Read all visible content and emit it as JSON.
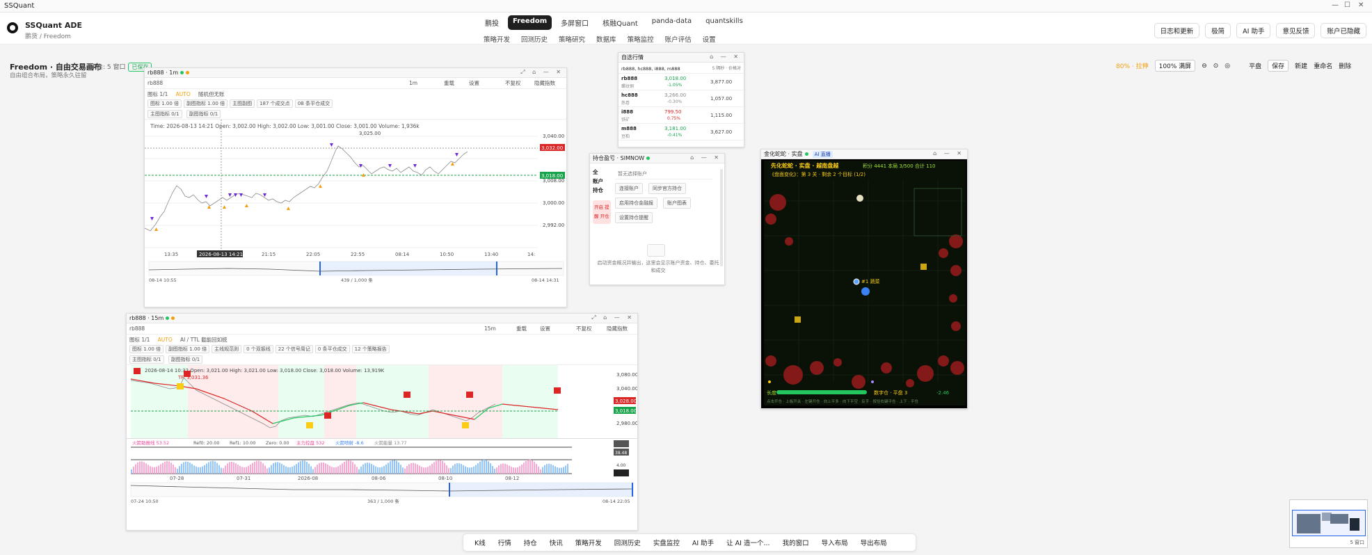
{
  "window": {
    "title": "SSQuant"
  },
  "header": {
    "brand": "SSQuant ADE",
    "breadcrumb": "鹏货 / Freedom",
    "nav_row1": [
      "鹏投",
      "Freedom",
      "多屏窗口",
      "核融Quant",
      "panda-data",
      "quantskills"
    ],
    "nav_row2": [
      "策略开发",
      "回测历史",
      "策略研究",
      "数据库",
      "策略监控",
      "账户评估",
      "设置"
    ],
    "right_buttons": [
      "日志和更新",
      "极简",
      "AI 助手",
      "意见反馈",
      "账户已隐藏"
    ]
  },
  "page": {
    "title": "Freedom · 自由交易画布",
    "meta": "平台: 5 窗口",
    "badge": "已保存",
    "subtitle": "自由组合布局，策略永久驻留",
    "zoom_hint": "80% · 拉伸",
    "zoom": "100% 满屏",
    "layout_select": "平盘",
    "actions": [
      "保存",
      "新建",
      "重命名",
      "删除"
    ]
  },
  "kline1": {
    "title": "rb888 · 1m",
    "symbol": "rb888",
    "period": "1m",
    "toolbar": [
      "重载",
      "设置",
      "不复权",
      "隐藏指数"
    ],
    "tabs": [
      "图标 1/1",
      "AUTO",
      "随机但无账"
    ],
    "chips": [
      "图标 1.00 倍",
      "副图指标 1.00 倍",
      "主图副图",
      "187 个成交点",
      "0B 条平仓成交"
    ],
    "subtabs": [
      "主图指标 0/1",
      "副图指标 0/1"
    ],
    "ohlc": "Time: 2026-08-13 14:21    Open: 3,002.00    High: 3,002.00    Low: 3,001.00    Close: 3,001.00    Volume: 1,936k",
    "price_ticks": [
      "3,040.00",
      "3,032.00",
      "3,024.00",
      "3,018.00",
      "3,008.00",
      "3,000.00",
      "2,992.00"
    ],
    "last_price": "3,032.00",
    "pos_price": "3,018.00",
    "peak_label": "3,025.00",
    "x_ticks": [
      "13:35",
      "2026-08-13 14:21",
      "21:15",
      "22:05",
      "22:55",
      "08:14",
      "10:50",
      "13:40",
      "14:"
    ],
    "range_left": "08-14 10:55",
    "range_mid": "439 / 1,000 条",
    "range_right": "08-14 14:31"
  },
  "kline2": {
    "title": "rb888 · 15m",
    "symbol": "rb888",
    "period": "15m",
    "toolbar": [
      "重载",
      "设置",
      "不复权",
      "隐藏指数"
    ],
    "tabs": [
      "图标 1/1",
      "AUTO",
      "AI / TTL 截能回如统"
    ],
    "chips": [
      "图标 1.00 倍",
      "副图指标 1.00 倍",
      "主线规范则",
      "0 个双振线",
      "22 个信号周记",
      "0 条平仓成交",
      "12 个策略报告"
    ],
    "subtabs": [
      "主图指标 0/1",
      "副图指标 0/1"
    ],
    "ohlc": "2026-08-14 10:32    Open: 3,021.00    High: 3,021.00    Low: 3,018.00    Close: 3,018.00    Volume: 13,919K",
    "indicator": "TF: 3,031.36",
    "price_ticks": [
      "3,080.00",
      "3,040.00",
      "3,010.00",
      "2,980.00"
    ],
    "last_price": "3,028.00",
    "pos_price": "3,018.00",
    "osc_labels": [
      "火箭助推线 53.52",
      "Ref0: 20.00",
      "Ref1: 10.00",
      "Zero: 0.00",
      "主力控盘 532",
      "火箭喷射 -8.6",
      "火箭能量 13.77"
    ],
    "osc_ticks": [
      "38.48",
      "4.00"
    ],
    "x_ticks": [
      "07-28",
      "07-31",
      "2026-08",
      "08-06",
      "08-10",
      "08-12"
    ],
    "range_left": "07-24 10:50",
    "range_mid": "363 / 1,000 条",
    "range_right": "08-14 22:05"
  },
  "quotes": {
    "title": "自选行情",
    "symbols_input": "rb888, hc888, i888, m888",
    "hint": "5 隔秒 · 价格对",
    "rows": [
      {
        "sym": "rb888",
        "name": "螺纹钢",
        "price": "3,018.00",
        "chg": "-1.05%",
        "vol": "3,877.00",
        "color": "#16a34a"
      },
      {
        "sym": "hc888",
        "name": "热卷",
        "price": "3,266.00",
        "chg": "-0.30%",
        "vol": "1,057.00",
        "color": "#888888"
      },
      {
        "sym": "i888",
        "name": "铁矿",
        "price": "799.50",
        "chg": "0.75%",
        "vol": "1,115.00",
        "color": "#dc2626"
      },
      {
        "sym": "m888",
        "name": "豆粕",
        "price": "3,181.00",
        "chg": "-0.41%",
        "vol": "3,627.00",
        "color": "#16a34a"
      }
    ]
  },
  "positions": {
    "title": "持仓盈亏 · SIMNOW",
    "side_labels": [
      "全",
      "账户",
      "持仓"
    ],
    "selector": "暂无选择账户",
    "buttons": [
      "连接账户",
      "同步官方持仓",
      "启用持仓金融报",
      "账户图表",
      "设置持仓提醒"
    ],
    "side_button": "开启 提醒 开仓",
    "empty_text": "启动资金概况并输出，这里会显示账户资金、持仓、委托和成交"
  },
  "game": {
    "title": "金化蛇蛇 · 实盘",
    "tag": "AI 直播",
    "banner": "先化蛇蛇 · 实盘 · 越南盘越",
    "stats": "积分 4441   本局 3/500   合计 110",
    "sub": "《盘面变化》：第 3 关 · 剩余 2 个目标 (1/2)",
    "player": "#1 蔬菜",
    "footer_left": "长度",
    "footer_mid": "数字仓 · 平盘 3",
    "footer_val": "-2.46",
    "footer2": "点击开仓 · 上板开关 · 左键开仓 · 向上平多 · 向下平空 · 反手 · 按住右键平仓 · 上下 · 平仓"
  },
  "bottombar": [
    "K线",
    "行情",
    "持仓",
    "快讯",
    "策略开发",
    "回测历史",
    "实盘监控",
    "AI 助手",
    "让 AI 造一个...",
    "我的窗口",
    "导入布局",
    "导出布局"
  ],
  "minimap": {
    "label": "5 窗口"
  },
  "colors": {
    "up": "#dc2626",
    "down": "#16a34a",
    "buy": "#f59e0b",
    "sell": "#6d28d9",
    "accent": "#1f1f1f"
  }
}
